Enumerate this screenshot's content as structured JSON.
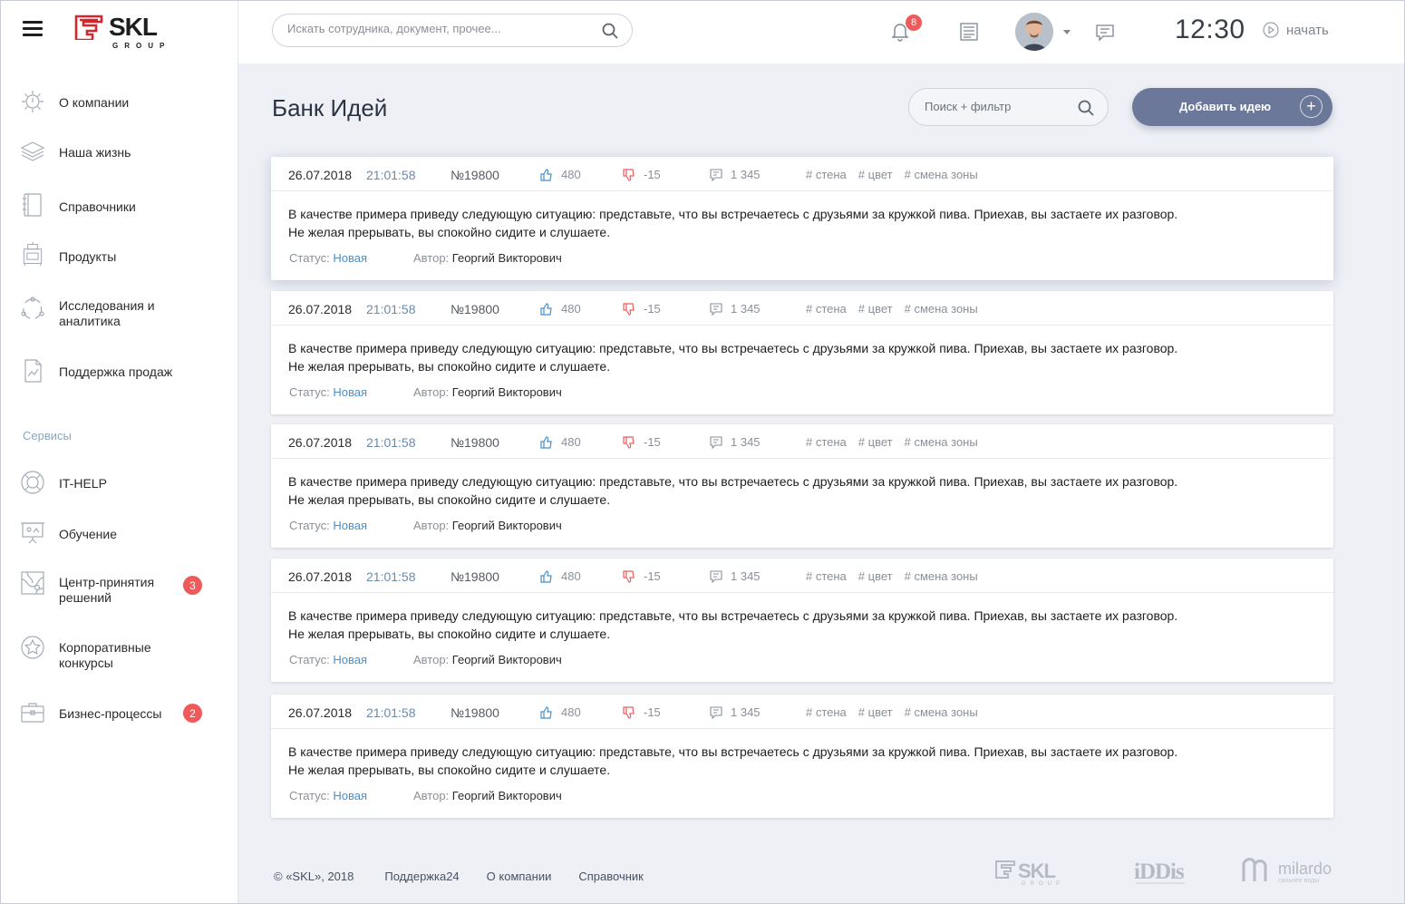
{
  "brand": {
    "name": "SKL",
    "sub": "GROUP"
  },
  "sidebar": {
    "items": [
      {
        "label": "О компании",
        "icon": "lightbulb-icon"
      },
      {
        "label": "Наша жизнь",
        "icon": "layers-icon"
      },
      {
        "label": "Справочники",
        "icon": "book-icon"
      },
      {
        "label": "Продукты",
        "icon": "cooker-icon"
      },
      {
        "label": "Исследования и аналитика",
        "icon": "cycle-icon"
      },
      {
        "label": "Поддержка продаж",
        "icon": "chart-document-icon"
      }
    ],
    "section_label": "Сервисы",
    "services": [
      {
        "label": "IT-HELP",
        "icon": "lifebuoy-icon"
      },
      {
        "label": "Обучение",
        "icon": "presentation-icon"
      },
      {
        "label": "Центр-принятия решений",
        "icon": "map-icon",
        "badge": "3"
      },
      {
        "label": "Корпоративные конкурсы",
        "icon": "star-icon"
      },
      {
        "label": "Бизнес-процессы",
        "icon": "briefcase-icon",
        "badge": "2"
      }
    ]
  },
  "topbar": {
    "search_placeholder": "Искать сотрудника, документ, прочее...",
    "notifications_count": "8",
    "clock": "12:30",
    "start_label": "начать"
  },
  "main": {
    "title": "Банк Идей",
    "filter_placeholder": "Поиск + фильтр",
    "add_label": "Добавить идею"
  },
  "labels": {
    "status": "Статус:",
    "author": "Автор:"
  },
  "ideas": [
    {
      "date": "26.07.2018",
      "time": "21:01:58",
      "number": "№19800",
      "likes": "480",
      "dislikes": "-15",
      "comments": "1 345",
      "tags": [
        "# стена",
        "# цвет",
        "# смена зоны"
      ],
      "text_line1": "В качестве примера приведу следующую ситуацию: представьте, что вы встречаетесь с друзьями за кружкой пива. Приехав, вы застаете их разговор.",
      "text_line2": "Не желая прерывать, вы спокойно сидите и слушаете.",
      "status": "Новая",
      "author": "Георгий Викторович"
    },
    {
      "date": "26.07.2018",
      "time": "21:01:58",
      "number": "№19800",
      "likes": "480",
      "dislikes": "-15",
      "comments": "1 345",
      "tags": [
        "# стена",
        "# цвет",
        "# смена зоны"
      ],
      "text_line1": "В качестве примера приведу следующую ситуацию: представьте, что вы встречаетесь с друзьями за кружкой пива. Приехав, вы застаете их разговор.",
      "text_line2": "Не желая прерывать, вы спокойно сидите и слушаете.",
      "status": "Новая",
      "author": "Георгий Викторович"
    },
    {
      "date": "26.07.2018",
      "time": "21:01:58",
      "number": "№19800",
      "likes": "480",
      "dislikes": "-15",
      "comments": "1 345",
      "tags": [
        "# стена",
        "# цвет",
        "# смена зоны"
      ],
      "text_line1": "В качестве примера приведу следующую ситуацию: представьте, что вы встречаетесь с друзьями за кружкой пива. Приехав, вы застаете их разговор.",
      "text_line2": "Не желая прерывать, вы спокойно сидите и слушаете.",
      "status": "Новая",
      "author": "Георгий Викторович"
    },
    {
      "date": "26.07.2018",
      "time": "21:01:58",
      "number": "№19800",
      "likes": "480",
      "dislikes": "-15",
      "comments": "1 345",
      "tags": [
        "# стена",
        "# цвет",
        "# смена зоны"
      ],
      "text_line1": "В качестве примера приведу следующую ситуацию: представьте, что вы встречаетесь с друзьями за кружкой пива. Приехав, вы застаете их разговор.",
      "text_line2": "Не желая прерывать, вы спокойно сидите и слушаете.",
      "status": "Новая",
      "author": "Георгий Викторович"
    },
    {
      "date": "26.07.2018",
      "time": "21:01:58",
      "number": "№19800",
      "likes": "480",
      "dislikes": "-15",
      "comments": "1 345",
      "tags": [
        "# стена",
        "# цвет",
        "# смена зоны"
      ],
      "text_line1": "В качестве примера приведу следующую ситуацию: представьте, что вы встречаетесь с друзьями за кружкой пива. Приехав, вы застаете их разговор.",
      "text_line2": "Не желая прерывать, вы спокойно сидите и слушаете.",
      "status": "Новая",
      "author": "Георгий Викторович"
    }
  ],
  "footer": {
    "copyright": "© «SKL», 2018",
    "links": [
      "Поддержка24",
      "О компании",
      "Справочник"
    ],
    "partner_logos": [
      "SKL GROUP",
      "iDDis",
      "milardo"
    ]
  },
  "colors": {
    "accent": "#6b7899",
    "badge": "#ef5b5b",
    "link": "#4a8fc7",
    "background": "#eef0f6"
  }
}
